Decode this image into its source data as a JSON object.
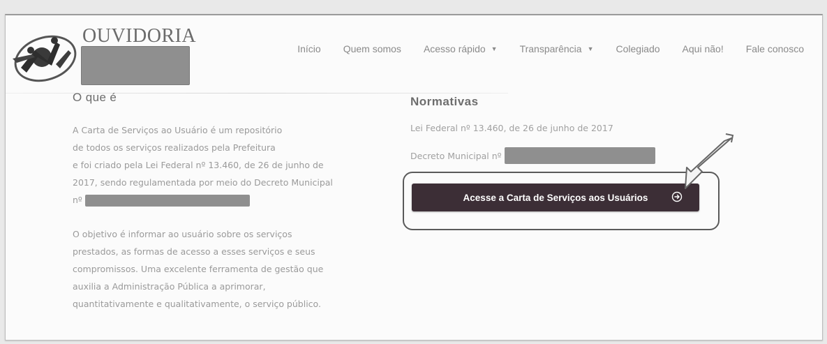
{
  "header": {
    "brand": "OUVIDORIA",
    "nav": [
      {
        "label": "Início",
        "dropdown": false
      },
      {
        "label": "Quem somos",
        "dropdown": false
      },
      {
        "label": "Acesso rápido",
        "dropdown": true
      },
      {
        "label": "Transparência",
        "dropdown": true
      },
      {
        "label": "Colegiado",
        "dropdown": false
      },
      {
        "label": "Aqui não!",
        "dropdown": false
      },
      {
        "label": "Fale conosco",
        "dropdown": false
      }
    ]
  },
  "left": {
    "title": "O que é",
    "para1": [
      "A Carta de Serviços ao Usuário é um repositório",
      "de todos os serviços realizados pela Prefeitura",
      "e foi criado pela Lei Federal nº 13.460, de 26 de junho de",
      "2017, sendo regulamentada por meio do Decreto Municipal"
    ],
    "para1_last_prefix": "nº",
    "para2": [
      "O objetivo é informar ao usuário sobre os serviços",
      "prestados, as formas de acesso a esses serviços e seus",
      "compromissos. Uma excelente ferramenta de gestão que",
      "auxilia a Administração Pública a aprimorar,",
      "quantitativamente e qualitativamente, o serviço público."
    ]
  },
  "right": {
    "title": "Normativas",
    "lei": "Lei Federal nº 13.460, de 26 de junho de 2017",
    "decreto": "Decreto Municipal nº",
    "cta_label": "Acesse a Carta de Serviços aos Usuários"
  },
  "colors": {
    "cta_bg": "#3c2e36",
    "text_muted": "#9a9a9a",
    "redaction": "#8f8f8f"
  },
  "icons": {
    "logo": "people-circle-logo",
    "cta": "arrow-circle-right-icon",
    "annotation": "pointing-arrow"
  }
}
